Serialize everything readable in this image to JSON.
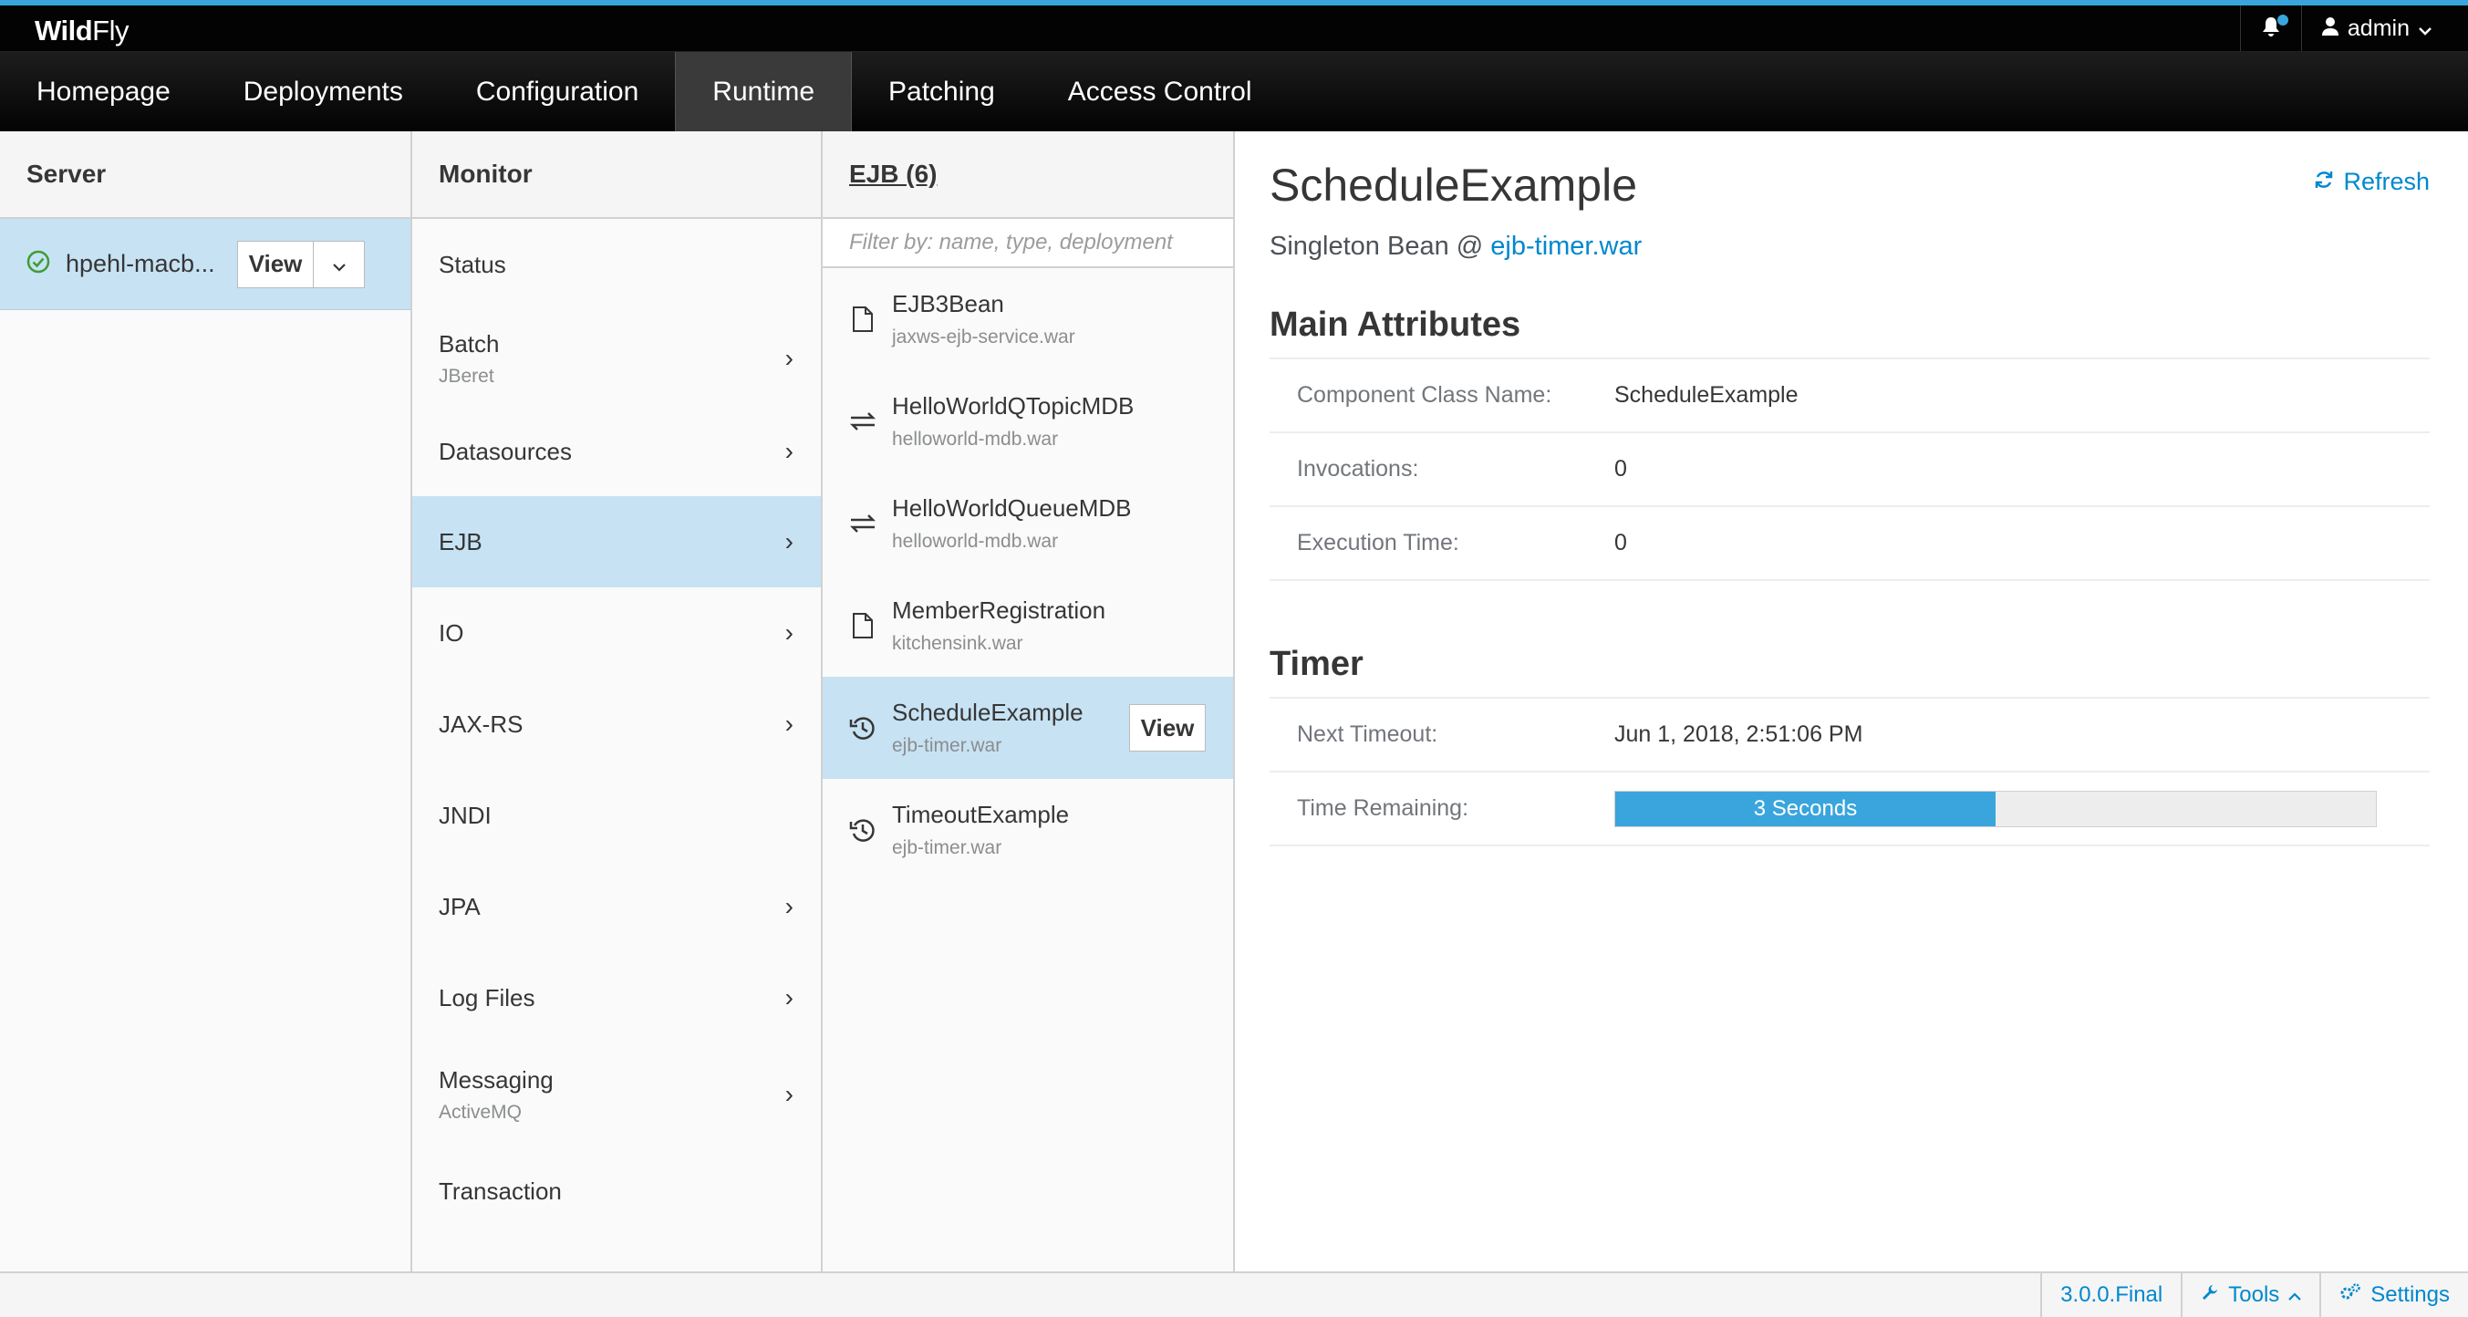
{
  "brand": {
    "bold": "Wild",
    "light": "Fly"
  },
  "user": {
    "name": "admin"
  },
  "nav": [
    {
      "label": "Homepage"
    },
    {
      "label": "Deployments"
    },
    {
      "label": "Configuration"
    },
    {
      "label": "Runtime",
      "active": true
    },
    {
      "label": "Patching"
    },
    {
      "label": "Access Control"
    }
  ],
  "server_col": {
    "header": "Server",
    "item": {
      "name": "hpehl-macb...",
      "view_label": "View"
    }
  },
  "monitor_col": {
    "header": "Monitor",
    "items": [
      {
        "label": "Status",
        "sub": "",
        "chevron": false
      },
      {
        "label": "Batch",
        "sub": "JBeret",
        "chevron": true
      },
      {
        "label": "Datasources",
        "sub": "",
        "chevron": true
      },
      {
        "label": "EJB",
        "sub": "",
        "chevron": true,
        "active": true
      },
      {
        "label": "IO",
        "sub": "",
        "chevron": true
      },
      {
        "label": "JAX-RS",
        "sub": "",
        "chevron": true
      },
      {
        "label": "JNDI",
        "sub": "",
        "chevron": false
      },
      {
        "label": "JPA",
        "sub": "",
        "chevron": true
      },
      {
        "label": "Log Files",
        "sub": "",
        "chevron": true
      },
      {
        "label": "Messaging",
        "sub": "ActiveMQ",
        "chevron": true
      },
      {
        "label": "Transaction",
        "sub": "",
        "chevron": false
      }
    ]
  },
  "ejb_col": {
    "header": "EJB (6)",
    "filter_placeholder": "Filter by: name, type, deployment",
    "view_label": "View",
    "items": [
      {
        "name": "EJB3Bean",
        "deployment": "jaxws-ejb-service.war",
        "icon": "file-icon"
      },
      {
        "name": "HelloWorldQTopicMDB",
        "deployment": "helloworld-mdb.war",
        "icon": "exchange-icon"
      },
      {
        "name": "HelloWorldQueueMDB",
        "deployment": "helloworld-mdb.war",
        "icon": "exchange-icon"
      },
      {
        "name": "MemberRegistration",
        "deployment": "kitchensink.war",
        "icon": "file-icon"
      },
      {
        "name": "ScheduleExample",
        "deployment": "ejb-timer.war",
        "icon": "history-icon",
        "active": true
      },
      {
        "name": "TimeoutExample",
        "deployment": "ejb-timer.war",
        "icon": "history-icon"
      }
    ]
  },
  "detail": {
    "title": "ScheduleExample",
    "subtitle_prefix": "Singleton Bean @ ",
    "subtitle_link": "ejb-timer.war",
    "refresh_label": "Refresh",
    "main_attributes": {
      "heading": "Main Attributes",
      "rows": [
        {
          "label": "Component Class Name:",
          "value": "ScheduleExample"
        },
        {
          "label": "Invocations:",
          "value": "0"
        },
        {
          "label": "Execution Time:",
          "value": "0"
        }
      ]
    },
    "timer": {
      "heading": "Timer",
      "next_timeout_label": "Next Timeout:",
      "next_timeout_value": "Jun 1, 2018, 2:51:06 PM",
      "remaining_label": "Time Remaining:",
      "remaining_text": "3 Seconds",
      "remaining_fraction": 0.5
    }
  },
  "footer": {
    "version": "3.0.0.Final",
    "tools": "Tools",
    "settings": "Settings"
  },
  "colors": {
    "accent": "#39a5dc",
    "link": "#0088ce",
    "selected": "#c7e2f3",
    "ok": "#3f9c35"
  }
}
